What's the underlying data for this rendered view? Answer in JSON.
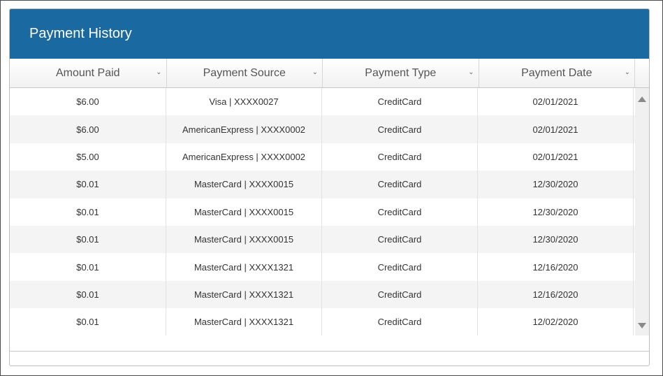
{
  "panel": {
    "title": "Payment History"
  },
  "columns": [
    {
      "label": "Amount Paid"
    },
    {
      "label": "Payment Source"
    },
    {
      "label": "Payment Type"
    },
    {
      "label": "Payment Date"
    }
  ],
  "rows": [
    {
      "amount": "$6.00",
      "source": "Visa | XXXX0027",
      "type": "CreditCard",
      "date": "02/01/2021"
    },
    {
      "amount": "$6.00",
      "source": "AmericanExpress | XXXX0002",
      "type": "CreditCard",
      "date": "02/01/2021"
    },
    {
      "amount": "$5.00",
      "source": "AmericanExpress | XXXX0002",
      "type": "CreditCard",
      "date": "02/01/2021"
    },
    {
      "amount": "$0.01",
      "source": "MasterCard | XXXX0015",
      "type": "CreditCard",
      "date": "12/30/2020"
    },
    {
      "amount": "$0.01",
      "source": "MasterCard | XXXX0015",
      "type": "CreditCard",
      "date": "12/30/2020"
    },
    {
      "amount": "$0.01",
      "source": "MasterCard | XXXX0015",
      "type": "CreditCard",
      "date": "12/30/2020"
    },
    {
      "amount": "$0.01",
      "source": "MasterCard | XXXX1321",
      "type": "CreditCard",
      "date": "12/16/2020"
    },
    {
      "amount": "$0.01",
      "source": "MasterCard | XXXX1321",
      "type": "CreditCard",
      "date": "12/16/2020"
    },
    {
      "amount": "$0.01",
      "source": "MasterCard | XXXX1321",
      "type": "CreditCard",
      "date": "12/02/2020"
    }
  ],
  "colors": {
    "header_bg": "#1a69a1",
    "alt_row_bg": "#f4f4f4"
  },
  "icons": {
    "sort": "chevron-down-icon",
    "scroll_up": "triangle-up-icon",
    "scroll_down": "triangle-down-icon"
  }
}
